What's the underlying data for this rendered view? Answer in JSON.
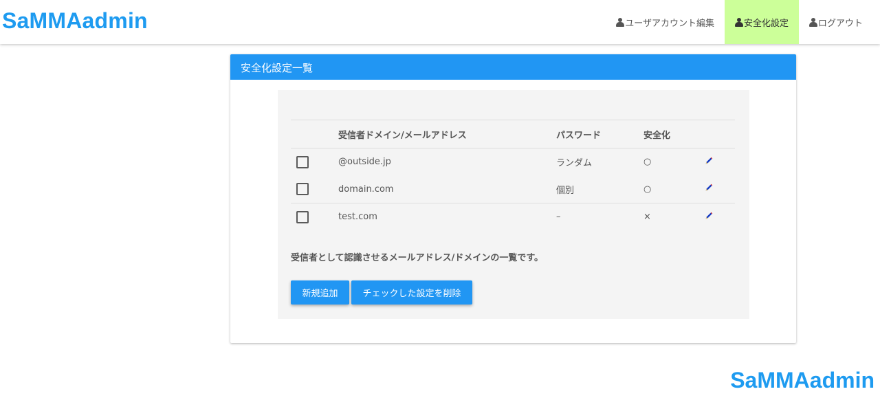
{
  "header": {
    "brand": "SaMMAadmin",
    "nav": [
      {
        "label": "ユーザアカウント編集",
        "active": false
      },
      {
        "label": "安全化設定",
        "active": true
      },
      {
        "label": "ログアウト",
        "active": false
      }
    ]
  },
  "card": {
    "title": "安全化設定一覧",
    "table": {
      "columns": [
        "受信者ドメイン/メールアドレス",
        "パスワード",
        "安全化"
      ],
      "rows": [
        {
          "address": "@outside.jp",
          "password": "ランダム",
          "secure": "○"
        },
        {
          "address": "domain.com",
          "password": "個別",
          "secure": "○"
        },
        {
          "address": "test.com",
          "password": "–",
          "secure": "×"
        }
      ]
    },
    "description": "受信者として認識させるメールアドレス/ドメインの一覧です。",
    "buttons": {
      "add": "新規追加",
      "delete": "チェックした設定を削除"
    }
  },
  "footer": {
    "brand": "SaMMAadmin"
  },
  "colors": {
    "accent": "#2196f3",
    "brand": "#1e9bf0",
    "active_nav": "#ccff99",
    "pencil": "#1a3ec2"
  },
  "icons": [
    "user-icon",
    "pencil-icon"
  ]
}
